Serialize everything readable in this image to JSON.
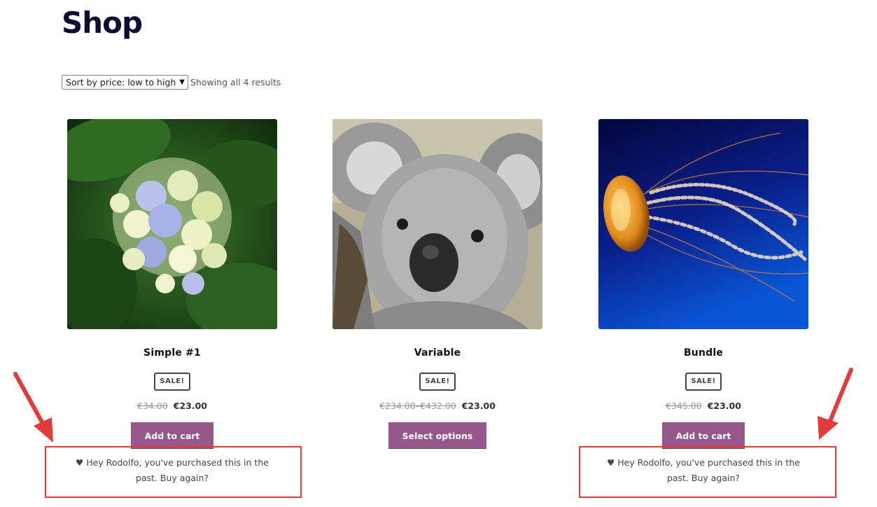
{
  "page": {
    "title": "Shop"
  },
  "toolbar": {
    "sort_selected": "Sort by price: low to high",
    "result_count": "Showing all 4 results"
  },
  "products": [
    {
      "image": "hydrangea-flower-photo",
      "title": "Simple #1",
      "badge": "SALE!",
      "price_old": "€34.00",
      "price_new": "€23.00",
      "button": "Add to cart",
      "notice": "♥ Hey Rodolfo, you've purchased this in the past. Buy again?"
    },
    {
      "image": "koala-photo",
      "title": "Variable",
      "badge": "SALE!",
      "price_old": "€234.00–€432.00",
      "price_new": "€23.00",
      "button": "Select options"
    },
    {
      "image": "jellyfish-photo",
      "title": "Bundle",
      "badge": "SALE!",
      "price_old": "€345.00",
      "price_new": "€23.00",
      "button": "Add to cart",
      "notice": "♥ Hey Rodolfo, you've purchased this in the past. Buy again?"
    }
  ],
  "colors": {
    "button": "#96588a",
    "title": "#0b0d33",
    "annotation": "#e03c3c"
  }
}
